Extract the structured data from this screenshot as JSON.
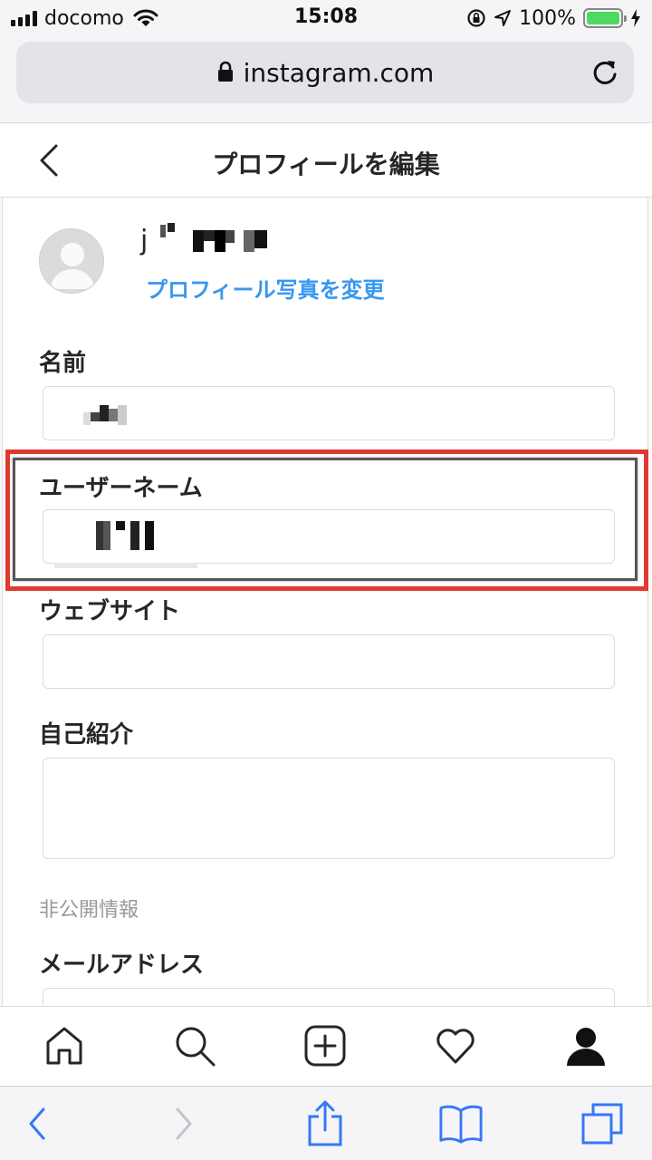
{
  "status_bar": {
    "carrier": "docomo",
    "time": "15:08",
    "battery": "100%",
    "battery_level": 1.0
  },
  "browser": {
    "url": "instagram.com"
  },
  "header": {
    "title": "プロフィールを編集"
  },
  "profile": {
    "username_prefix": "j",
    "change_photo_label": "プロフィール写真を変更"
  },
  "form": {
    "name_label": "名前",
    "username_label": "ユーザーネーム",
    "website_label": "ウェブサイト",
    "bio_label": "自己紹介",
    "private_info_label": "非公開情報",
    "email_label": "メールアドレス"
  },
  "colors": {
    "accent": "#3897f0",
    "highlight": "#e03a2f",
    "battery": "#4cd964"
  },
  "icons": {
    "tabs": [
      "home-icon",
      "search-icon",
      "new-post-icon",
      "activity-heart-icon",
      "profile-icon"
    ],
    "toolbar": [
      "back-icon",
      "forward-icon",
      "share-icon",
      "bookmarks-icon",
      "tabs-icon"
    ]
  }
}
